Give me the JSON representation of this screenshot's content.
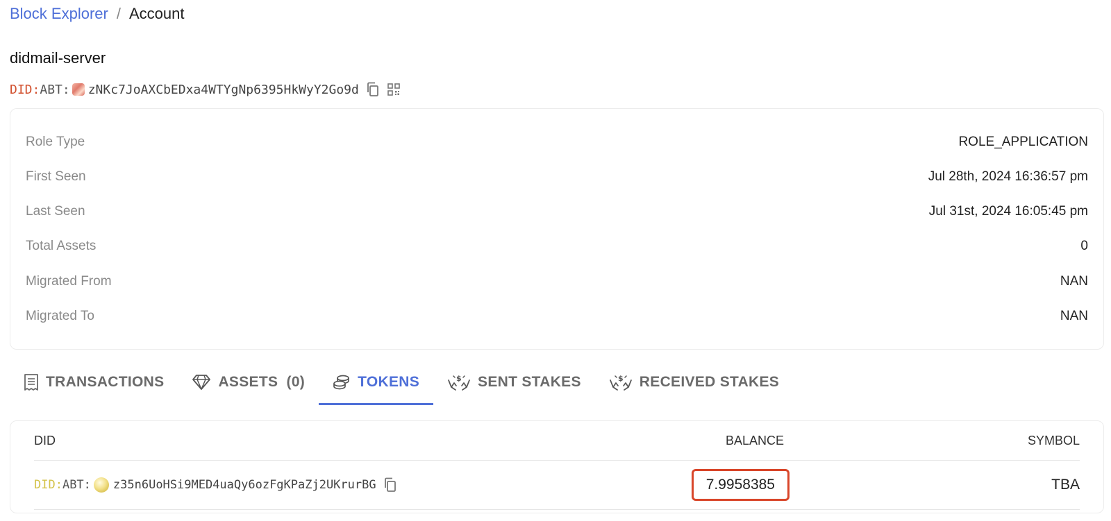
{
  "breadcrumb": {
    "root": "Block Explorer",
    "separator": "/",
    "current": "Account"
  },
  "account": {
    "name": "didmail-server",
    "did_prefix": "DID:",
    "did_chain": "ABT:",
    "address": "zNKc7JoAXCbEDxa4WTYgNp6395HkWyY2Go9d"
  },
  "info": [
    {
      "label": "Role Type",
      "value": "ROLE_APPLICATION"
    },
    {
      "label": "First Seen",
      "value": "Jul 28th, 2024 16:36:57 pm"
    },
    {
      "label": "Last Seen",
      "value": "Jul 31st, 2024 16:05:45 pm"
    },
    {
      "label": "Total Assets",
      "value": "0"
    },
    {
      "label": "Migrated From",
      "value": "NAN"
    },
    {
      "label": "Migrated To",
      "value": "NAN"
    }
  ],
  "tabs": [
    {
      "label": "TRANSACTIONS",
      "icon": "receipt-icon"
    },
    {
      "label": "ASSETS  (0)",
      "icon": "diamond-icon"
    },
    {
      "label": "TOKENS",
      "icon": "coins-icon",
      "active": true
    },
    {
      "label": "SENT STAKES",
      "icon": "hand-coin-icon"
    },
    {
      "label": "RECEIVED STAKES",
      "icon": "hand-coin-icon"
    }
  ],
  "tokens_table": {
    "headers": {
      "did": "DID",
      "balance": "BALANCE",
      "symbol": "SYMBOL"
    },
    "rows": [
      {
        "did_prefix": "DID:",
        "did_chain": "ABT:",
        "address": "z35n6UoHSi9MED4uaQy6ozFgKPaZj2UKrurBG",
        "balance": "7.9958385",
        "symbol": "TBA"
      }
    ]
  },
  "colors": {
    "accent": "#4e6fd8",
    "did_red": "#d2512f",
    "did_gold": "#d4c34a",
    "highlight_border": "#d9462a"
  }
}
